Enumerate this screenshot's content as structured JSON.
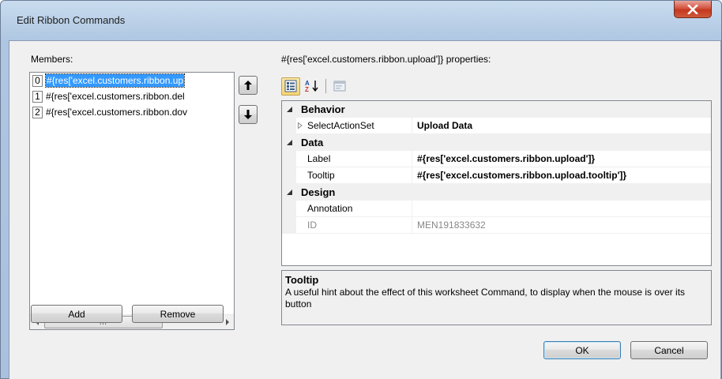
{
  "window": {
    "title": "Edit Ribbon Commands",
    "close_icon": "close-x-icon"
  },
  "members": {
    "label": "Members:",
    "items": [
      {
        "index": "0",
        "text": "#{res['excel.customers.ribbon.up",
        "selected": true
      },
      {
        "index": "1",
        "text": "#{res['excel.customers.ribbon.del",
        "selected": false
      },
      {
        "index": "2",
        "text": "#{res['excel.customers.ribbon.dov",
        "selected": false
      }
    ],
    "scroll_grip": "III",
    "move_up_icon": "arrow-up-icon",
    "move_down_icon": "arrow-down-icon",
    "add_label": "Add",
    "remove_label": "Remove"
  },
  "properties": {
    "header": "#{res['excel.customers.ribbon.upload']} properties:",
    "toolbar": {
      "categorized_icon": "categorized-icon",
      "alphabetical_icon": "sort-az-icon",
      "property_pages_icon": "property-pages-icon"
    },
    "categories": [
      {
        "name": "Behavior",
        "rows": [
          {
            "name": "SelectActionSet",
            "value": "Upload Data",
            "bold": true,
            "expandable": true,
            "readonly": false
          }
        ]
      },
      {
        "name": "Data",
        "rows": [
          {
            "name": "Label",
            "value": "#{res['excel.customers.ribbon.upload']}",
            "bold": true,
            "expandable": false,
            "readonly": false
          },
          {
            "name": "Tooltip",
            "value": "#{res['excel.customers.ribbon.upload.tooltip']}",
            "bold": true,
            "expandable": false,
            "readonly": false
          }
        ]
      },
      {
        "name": "Design",
        "rows": [
          {
            "name": "Annotation",
            "value": "",
            "bold": false,
            "expandable": false,
            "readonly": false
          },
          {
            "name": "ID",
            "value": "MEN191833632",
            "bold": false,
            "expandable": false,
            "readonly": true
          }
        ]
      }
    ],
    "description": {
      "title": "Tooltip",
      "text": "A useful hint about the effect of this worksheet Command, to display when the mouse is over its button"
    }
  },
  "buttons": {
    "ok_label": "OK",
    "cancel_label": "Cancel"
  }
}
